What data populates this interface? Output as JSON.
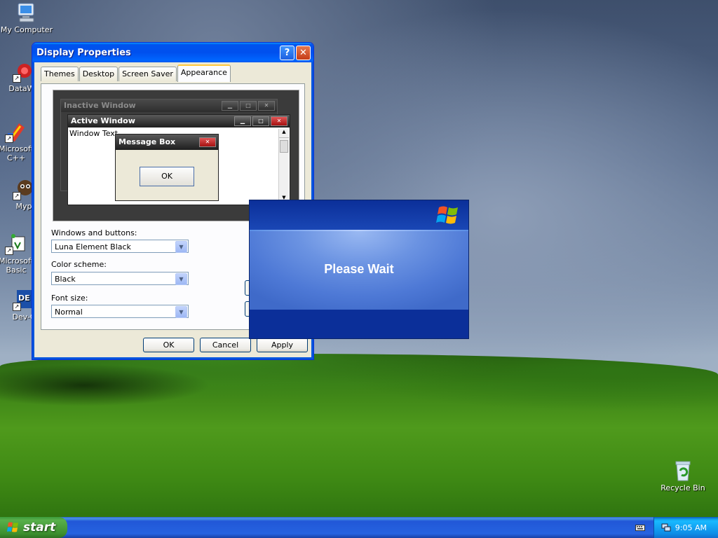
{
  "desktop": {
    "icons": [
      {
        "label": "My Computer"
      },
      {
        "label": "DataWa"
      },
      {
        "label": "Microsoft C++"
      },
      {
        "label": "Myp"
      },
      {
        "label": "Microsoft Basic"
      },
      {
        "label": "Dev-C"
      },
      {
        "label": "Recycle Bin"
      }
    ]
  },
  "dialog": {
    "title": "Display Properties",
    "help_glyph": "?",
    "close_glyph": "✕",
    "tabs": [
      {
        "label": "Themes"
      },
      {
        "label": "Desktop"
      },
      {
        "label": "Screen Saver"
      },
      {
        "label": "Appearance",
        "active": true
      }
    ],
    "preview": {
      "inactive_title": "Inactive Window",
      "active_title": "Active Window",
      "window_text": "Window Text",
      "msgbox_title": "Message Box",
      "msgbox_ok": "OK"
    },
    "windows_and_buttons_label": "Windows and buttons:",
    "windows_and_buttons_value": "Luna Element Black",
    "color_scheme_label": "Color scheme:",
    "color_scheme_value": "Black",
    "font_size_label": "Font size:",
    "font_size_value": "Normal",
    "ok": "OK",
    "cancel": "Cancel",
    "apply": "Apply"
  },
  "wait_dialog": {
    "message": "Please Wait"
  },
  "taskbar": {
    "start": "start",
    "clock": "9:05 AM"
  }
}
